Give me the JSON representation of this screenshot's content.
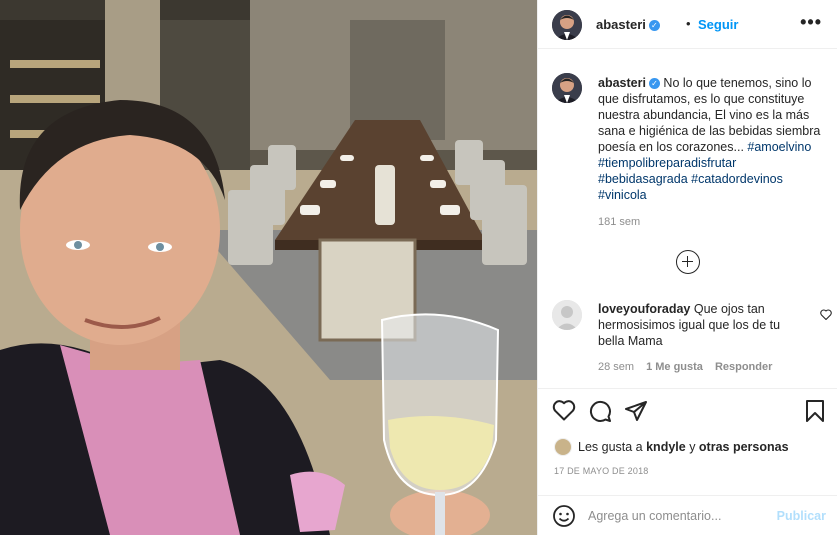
{
  "post": {
    "username": "abasteri",
    "verified_glyph": "✓",
    "dot": "•",
    "follow_label": "Seguir",
    "more_label": "•••"
  },
  "caption": {
    "username": "abasteri",
    "body": " No lo que tenemos, sino lo que disfrutamos, es lo que constituye nuestra abundancia, El vino es la más sana e higiénica de las bebidas siembra poesía en los corazones... ",
    "hashtags": [
      "#amoelvino",
      "#tiempolibreparadisfrutar",
      "#bebidasagrada",
      "#catadordevinos",
      "#vinicola"
    ],
    "time": "181 sem"
  },
  "comment": {
    "username": "loveyouforaday",
    "text": " Que ojos tan hermosisimos igual que los de tu bella Mama",
    "time": "28 sem",
    "likes": "1 Me gusta",
    "reply": "Responder"
  },
  "likes": {
    "prefix": "Les gusta a ",
    "user": "kndyle",
    "middle": " y ",
    "others": "otras personas"
  },
  "date": "17 DE MAYO DE 2018",
  "add_comment": {
    "placeholder": "Agrega un comentario...",
    "publish_label": "Publicar"
  },
  "icons": {
    "verified": "verified-badge-icon",
    "load_more": "plus-circle-icon",
    "like": "heart-icon",
    "comment": "comment-icon",
    "share": "paper-plane-icon",
    "save": "bookmark-icon",
    "emoji": "emoji-icon"
  },
  "colors": {
    "link_blue": "#0095f6",
    "publish_disabled": "#b2dffc",
    "verified_blue": "#3897f0",
    "muted": "#8e8e8e"
  }
}
